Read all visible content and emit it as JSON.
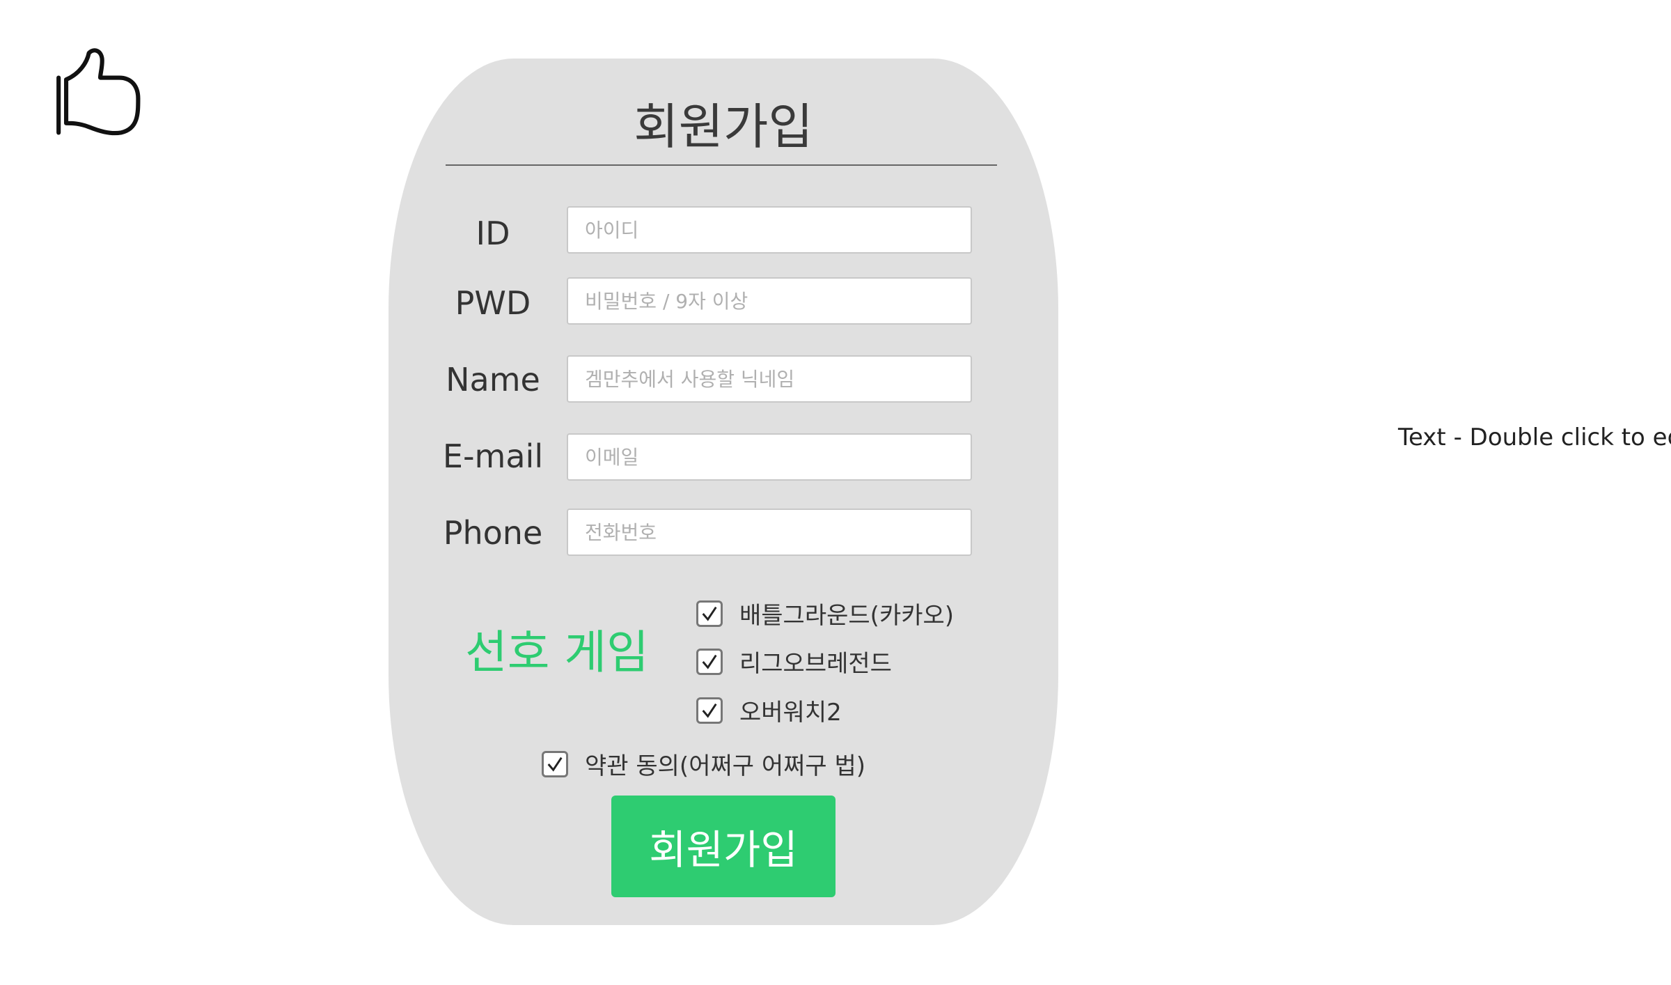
{
  "logo": {
    "icon": "thumbs-up-icon"
  },
  "form": {
    "title": "회원가입",
    "fields": [
      {
        "label": "ID",
        "placeholder": "아이디",
        "value": ""
      },
      {
        "label": "PWD",
        "placeholder": "비밀번호 / 9자 이상",
        "value": ""
      },
      {
        "label": "Name",
        "placeholder": "겜만추에서 사용할 닉네임",
        "value": ""
      },
      {
        "label": "E-mail",
        "placeholder": "이메일",
        "value": ""
      },
      {
        "label": "Phone",
        "placeholder": "전화번호",
        "value": ""
      }
    ],
    "preferred_games": {
      "label": "선호 게임",
      "options": [
        {
          "label": "배틀그라운드(카카오)",
          "checked": true
        },
        {
          "label": "리그오브레전드",
          "checked": true
        },
        {
          "label": "오버워치2",
          "checked": true
        }
      ]
    },
    "terms": {
      "label": "약관 동의(어쩌구 어쩌구 법)",
      "checked": true
    },
    "submit_label": "회원가입"
  },
  "side_text": "Text - Double click to edit",
  "colors": {
    "card_bg": "#e0e0e0",
    "accent": "#2ecc71",
    "text": "#333333"
  }
}
